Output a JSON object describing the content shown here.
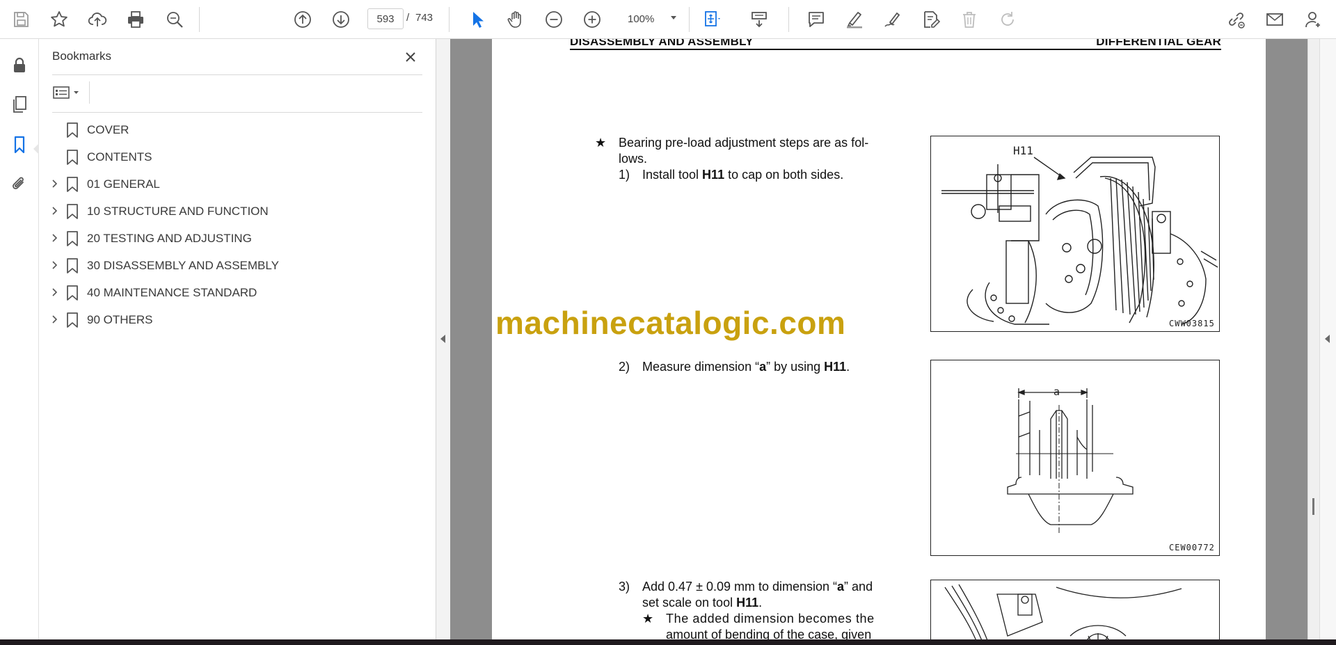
{
  "toolbar": {
    "page_current": "593",
    "page_separator": "/",
    "page_total": "743",
    "zoom": "100%",
    "buttons": [
      "save-icon",
      "star-icon",
      "upload-icon",
      "print-icon",
      "search-icon",
      "page-up-icon",
      "page-down-icon",
      "select-pointer-icon",
      "hand-icon",
      "zoom-out-icon",
      "zoom-in-icon",
      "fit-page-icon",
      "scroll-mode-icon",
      "comment-icon",
      "highlighter-icon",
      "sign-icon",
      "edit-pdf-icon",
      "delete-icon",
      "redo-icon",
      "share-link-icon",
      "email-icon",
      "account-icon"
    ]
  },
  "left_rail": [
    "lock-icon",
    "pages-icon",
    "bookmark-icon",
    "attachment-icon"
  ],
  "bookmarks": {
    "title": "Bookmarks",
    "items": [
      {
        "label": "COVER",
        "expandable": false
      },
      {
        "label": "CONTENTS",
        "expandable": false
      },
      {
        "label": "01 GENERAL",
        "expandable": true
      },
      {
        "label": "10 STRUCTURE AND FUNCTION",
        "expandable": true
      },
      {
        "label": "20 TESTING AND ADJUSTING",
        "expandable": true
      },
      {
        "label": "30 DISASSEMBLY AND ASSEMBLY",
        "expandable": true
      },
      {
        "label": "40 MAINTENANCE STANDARD",
        "expandable": true
      },
      {
        "label": "90 OTHERS",
        "expandable": true
      }
    ]
  },
  "document": {
    "header_left": "DISASSEMBLY AND ASSEMBLY",
    "header_right": "DIFFERENTIAL GEAR",
    "star1": "★",
    "star1_line1": "Bearing pre-load adjustment steps are as fol-",
    "star1_line2": "lows.",
    "step1_num": "1)",
    "step1_pre": "Install tool ",
    "step1_bold": "H11",
    "step1_post": " to cap on both sides.",
    "step2_num": "2)",
    "step2_pre": "Measure dimension “",
    "step2_bold_a": "a",
    "step2_mid": "” by using  ",
    "step2_bold_tool": "H11",
    "step2_post": ".",
    "step3_num": "3)",
    "step3_line1_pre": "Add 0.47 ± 0.09 mm to dimension “",
    "step3_line1_bold": "a",
    "step3_line1_post": "” and",
    "step3_line2_pre": "set scale on tool ",
    "step3_line2_bold": "H11",
    "step3_line2_post": ".",
    "star2": "★",
    "star2_line1": "The added dimension becomes the",
    "star2_line2": "amount of bending of the case, given",
    "fig1_label": "H11",
    "fig1_code": "CWW03815",
    "fig2_label": "a",
    "fig2_code": "CEW00772",
    "watermark": "machinecatalogic.com"
  }
}
